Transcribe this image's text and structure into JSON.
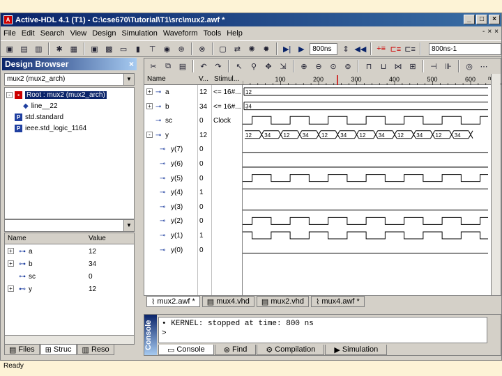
{
  "window": {
    "title": "Active-HDL 4.1 (T1) - C:\\cse670\\Tutorial\\T1\\src\\mux2.awf *",
    "min": "_",
    "max": "□",
    "close": "×"
  },
  "menu": [
    "File",
    "Edit",
    "Search",
    "View",
    "Design",
    "Simulation",
    "Waveform",
    "Tools",
    "Help"
  ],
  "mdi_buttons": [
    "-",
    "×",
    "×"
  ],
  "toolbar": {
    "sim_time": "800ns",
    "sim_end": "800ns-1"
  },
  "design_browser": {
    "title": "Design Browser",
    "close": "×",
    "combo_value": "mux2 (mux2_arch)",
    "tree": [
      {
        "label": "Root : mux2 (mux2_arch)",
        "expander": "-",
        "selected": true
      },
      {
        "label": "line__22"
      },
      {
        "label": "std.standard"
      },
      {
        "label": "ieee.std_logic_1164"
      }
    ],
    "columns": [
      "Name",
      "Value"
    ],
    "signals": [
      {
        "expander": "+",
        "name": "a",
        "value": "12"
      },
      {
        "expander": "+",
        "name": "b",
        "value": "34"
      },
      {
        "expander": "",
        "name": "sc",
        "value": "0"
      },
      {
        "expander": "+",
        "name": "y",
        "value": "12"
      }
    ],
    "tabs": [
      "Files",
      "Struc",
      "Reso"
    ]
  },
  "waveform": {
    "columns": [
      "Name",
      "V...",
      "Stimul..."
    ],
    "ruler_labels": [
      "100",
      "200",
      "300",
      "400",
      "500",
      "600"
    ],
    "ruler_unit": "ns",
    "rows": [
      {
        "expander": "+",
        "name": "a",
        "value": "12",
        "stim": "<= 16#..."
      },
      {
        "expander": "+",
        "name": "b",
        "value": "34",
        "stim": "<= 16#..."
      },
      {
        "expander": "",
        "name": "sc",
        "value": "0",
        "stim": "Clock"
      },
      {
        "expander": "-",
        "name": "y",
        "value": "12",
        "stim": ""
      },
      {
        "expander": "",
        "name": "y(7)",
        "value": "0",
        "stim": ""
      },
      {
        "expander": "",
        "name": "y(6)",
        "value": "0",
        "stim": ""
      },
      {
        "expander": "",
        "name": "y(5)",
        "value": "0",
        "stim": ""
      },
      {
        "expander": "",
        "name": "y(4)",
        "value": "1",
        "stim": ""
      },
      {
        "expander": "",
        "name": "y(3)",
        "value": "0",
        "stim": ""
      },
      {
        "expander": "",
        "name": "y(2)",
        "value": "0",
        "stim": ""
      },
      {
        "expander": "",
        "name": "y(1)",
        "value": "1",
        "stim": ""
      },
      {
        "expander": "",
        "name": "y(0)",
        "value": "0",
        "stim": ""
      }
    ],
    "bus_a": "12",
    "bus_b": "34",
    "bus_y_values": [
      "12",
      "34",
      "12",
      "34",
      "12",
      "34",
      "12",
      "34",
      "12",
      "34",
      "12",
      "34"
    ]
  },
  "doc_tabs": [
    "mux2.awf *",
    "mux4.vhd",
    "mux2.vhd",
    "mux4.awf *"
  ],
  "console": {
    "sidebar_label": "Console",
    "lines": [
      "• KERNEL: stopped at time: 800 ns",
      ">"
    ],
    "tabs": [
      "Console",
      "Find",
      "Compilation",
      "Simulation"
    ]
  },
  "status": "Ready"
}
